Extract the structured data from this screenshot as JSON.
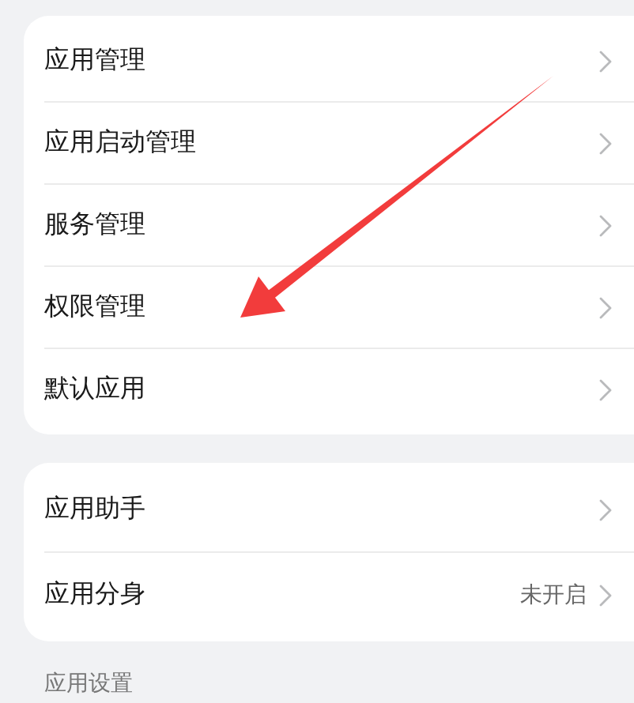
{
  "groups": [
    {
      "items": [
        {
          "label": "应用管理"
        },
        {
          "label": "应用启动管理"
        },
        {
          "label": "服务管理"
        },
        {
          "label": "权限管理"
        },
        {
          "label": "默认应用"
        }
      ]
    },
    {
      "items": [
        {
          "label": "应用助手"
        },
        {
          "label": "应用分身",
          "value": "未开启"
        }
      ]
    }
  ],
  "section_header": "应用设置"
}
